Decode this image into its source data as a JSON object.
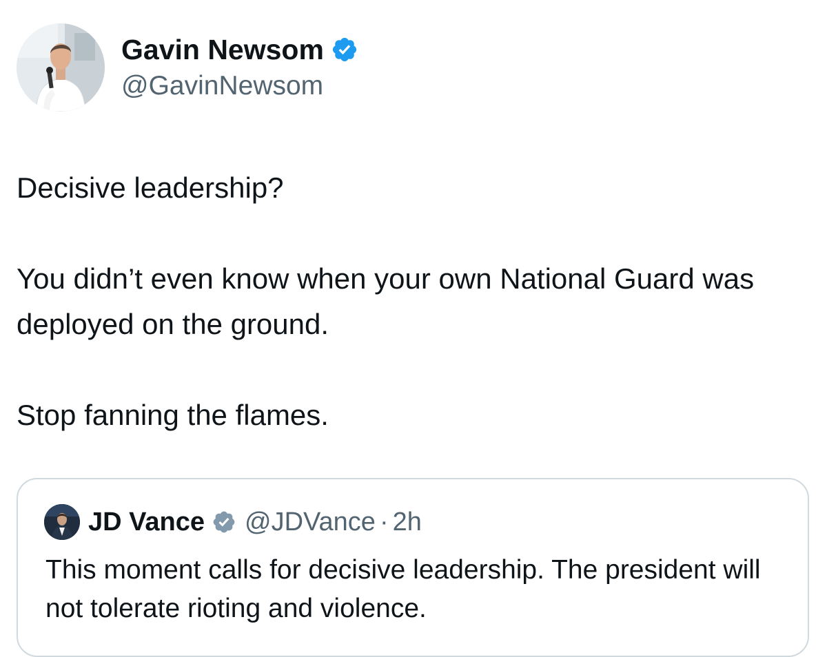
{
  "tweet": {
    "author": {
      "name": "Gavin Newsom",
      "handle": "@GavinNewsom",
      "verified": true,
      "avatar_icon": "profile-photo-avatar"
    },
    "paragraphs": [
      "Decisive leadership?",
      "You didn’t even know when your own National Guard was deployed on the ground.",
      "Stop fanning the flames."
    ]
  },
  "quote": {
    "author": {
      "name": "JD Vance",
      "handle": "@JDVance",
      "verified": true,
      "avatar_icon": "profile-photo-avatar"
    },
    "separator": "·",
    "time": "2h",
    "text": "This moment calls for decisive leadership. The president will not tolerate rioting and violence."
  },
  "colors": {
    "text": "#0f1419",
    "secondary_text": "#536471",
    "verified_blue": "#1d9bf0",
    "verified_gray": "#829aab",
    "border": "#cfd9de"
  }
}
